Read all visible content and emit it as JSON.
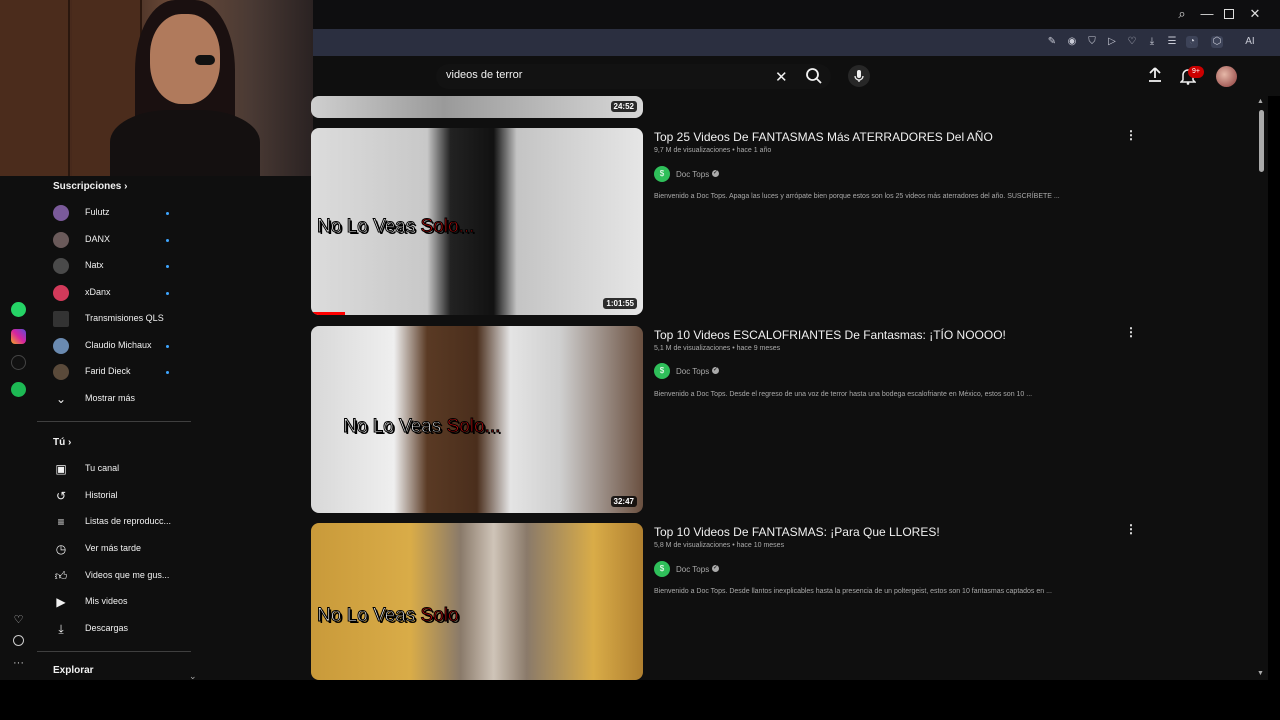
{
  "search": {
    "value": "videos de terror"
  },
  "header": {
    "notifications_badge": "9+",
    "ai_label": "AI"
  },
  "sidebar": {
    "subscriptions_heading": "Suscripciones",
    "channels": [
      {
        "label": "Fulutz",
        "color": "#7a5a9a",
        "new": true
      },
      {
        "label": "DANX",
        "color": "#6a5a5a",
        "new": true
      },
      {
        "label": "Natx",
        "color": "#4a4a4a",
        "new": true
      },
      {
        "label": "xDanx",
        "color": "#d23a5a",
        "new": true
      },
      {
        "label": "Transmisiones QLS",
        "color": "#333333",
        "new": false
      },
      {
        "label": "Claudio Michaux",
        "color": "#6a8ab0",
        "new": true
      },
      {
        "label": "Farid Dieck",
        "color": "#5a4a3a",
        "new": true
      }
    ],
    "show_more": "Mostrar más",
    "you_heading": "Tú",
    "you_items": [
      {
        "label": "Tu canal",
        "icon": "channel-icon"
      },
      {
        "label": "Historial",
        "icon": "history-icon"
      },
      {
        "label": "Listas de reproducc...",
        "icon": "playlist-icon"
      },
      {
        "label": "Ver más tarde",
        "icon": "clock-icon"
      },
      {
        "label": "Videos que me gus...",
        "icon": "thumb-up-icon"
      },
      {
        "label": "Mis videos",
        "icon": "my-videos-icon"
      },
      {
        "label": "Descargas",
        "icon": "download-icon"
      }
    ],
    "explore_heading": "Explorar"
  },
  "videos": [
    {
      "duration": "24:52"
    },
    {
      "title": "Top 25 Videos De FANTASMAS Más ATERRADORES Del AÑO",
      "meta": "9,7 M de visualizaciones  •  hace 1 año",
      "channel": "Doc Tops",
      "description": "Bienvenido a Doc Tops. Apaga las luces y arrópate bien porque estos son los 25 videos más aterradores del año. SUSCRÍBETE ...",
      "duration": "1:01:55",
      "caption_white": "No Lo Veas ",
      "caption_red": "Solo..."
    },
    {
      "title": "Top 10 Videos ESCALOFRIANTES De Fantasmas: ¡TÍO NOOOO!",
      "meta": "5,1 M de visualizaciones  •  hace 9 meses",
      "channel": "Doc Tops",
      "description": "Bienvenido a Doc Tops. Desde el regreso de una voz de terror hasta una bodega escalofriante en México, estos son 10 ...",
      "duration": "32:47",
      "caption_white": "No Lo Veas ",
      "caption_red": "Solo..."
    },
    {
      "title": "Top 10 Videos De FANTASMAS: ¡Para Que LLORES!",
      "meta": "5,8 M de visualizaciones  •  hace 10 meses",
      "channel": "Doc Tops",
      "description": "Bienvenido a Doc Tops. Desde llantos inexplicables hasta la presencia de un poltergeist, estos son 10 fantasmas captados en ...",
      "caption_white": "No Lo Veas ",
      "caption_red": "Solo"
    }
  ]
}
